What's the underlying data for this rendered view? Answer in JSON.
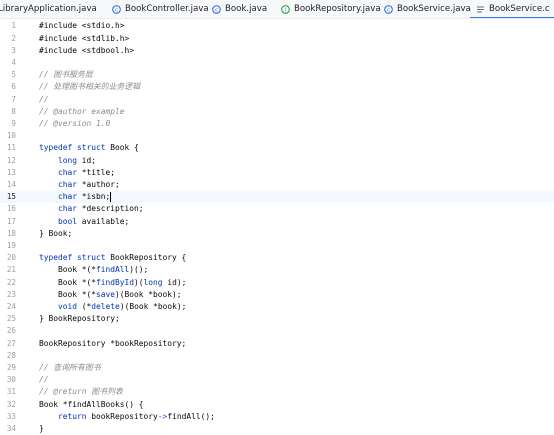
{
  "tabs": [
    {
      "label": "LibraryApplication.java",
      "icon": "java-class-icon",
      "active": false
    },
    {
      "label": "BookController.java",
      "icon": "java-class-icon",
      "active": false
    },
    {
      "label": "Book.java",
      "icon": "java-class-icon",
      "active": false
    },
    {
      "label": "BookRepository.java",
      "icon": "java-interface-icon",
      "active": false
    },
    {
      "label": "BookService.java",
      "icon": "java-class-icon",
      "active": false
    },
    {
      "label": "BookService.c",
      "icon": "text-file-icon",
      "active": true
    }
  ],
  "colors": {
    "accent": "#3574f0",
    "keyword": "#0033b3",
    "comment": "#8c8c8c",
    "current_line": "#f5f8fe"
  },
  "editor": {
    "current_line_number": 15,
    "lines": [
      {
        "n": "1",
        "tokens": [
          {
            "t": "#include <stdio.h>",
            "c": "pp"
          }
        ]
      },
      {
        "n": "2",
        "tokens": [
          {
            "t": "#include <stdlib.h>",
            "c": "pp"
          }
        ]
      },
      {
        "n": "3",
        "tokens": [
          {
            "t": "#include <stdbool.h>",
            "c": "pp"
          }
        ]
      },
      {
        "n": "4",
        "tokens": []
      },
      {
        "n": "5",
        "tokens": [
          {
            "t": "// 图书服务层",
            "c": "cm"
          }
        ]
      },
      {
        "n": "6",
        "tokens": [
          {
            "t": "// 处理图书相关的业务逻辑",
            "c": "cm"
          }
        ]
      },
      {
        "n": "7",
        "tokens": [
          {
            "t": "//",
            "c": "cm"
          }
        ]
      },
      {
        "n": "8",
        "tokens": [
          {
            "t": "// @author example",
            "c": "cm"
          }
        ]
      },
      {
        "n": "9",
        "tokens": [
          {
            "t": "// @version 1.0",
            "c": "cm"
          }
        ]
      },
      {
        "n": "10",
        "tokens": []
      },
      {
        "n": "11",
        "tokens": [
          {
            "t": "typedef",
            "c": "kw"
          },
          {
            "t": " "
          },
          {
            "t": "struct",
            "c": "kw"
          },
          {
            "t": " Book {"
          }
        ]
      },
      {
        "n": "12",
        "tokens": [
          {
            "t": "    "
          },
          {
            "t": "long",
            "c": "kw"
          },
          {
            "t": " id;"
          }
        ]
      },
      {
        "n": "13",
        "tokens": [
          {
            "t": "    "
          },
          {
            "t": "char",
            "c": "kw"
          },
          {
            "t": " *title;"
          }
        ]
      },
      {
        "n": "14",
        "tokens": [
          {
            "t": "    "
          },
          {
            "t": "char",
            "c": "kw"
          },
          {
            "t": " *author;"
          }
        ]
      },
      {
        "n": "15",
        "tokens": [
          {
            "t": "    "
          },
          {
            "t": "char",
            "c": "kw"
          },
          {
            "t": " *isbn;"
          }
        ],
        "caret": true
      },
      {
        "n": "16",
        "tokens": [
          {
            "t": "    "
          },
          {
            "t": "char",
            "c": "kw"
          },
          {
            "t": " *description;"
          }
        ]
      },
      {
        "n": "17",
        "tokens": [
          {
            "t": "    "
          },
          {
            "t": "bool",
            "c": "kw"
          },
          {
            "t": " available;"
          }
        ]
      },
      {
        "n": "18",
        "tokens": [
          {
            "t": "} Book;"
          }
        ]
      },
      {
        "n": "19",
        "tokens": []
      },
      {
        "n": "20",
        "tokens": [
          {
            "t": "typedef",
            "c": "kw"
          },
          {
            "t": " "
          },
          {
            "t": "struct",
            "c": "kw"
          },
          {
            "t": " BookRepository {"
          }
        ]
      },
      {
        "n": "21",
        "tokens": [
          {
            "t": "    Book *(*"
          },
          {
            "t": "findAll",
            "c": "kw"
          },
          {
            "t": ")();"
          }
        ]
      },
      {
        "n": "22",
        "tokens": [
          {
            "t": "    Book *(*"
          },
          {
            "t": "findById",
            "c": "kw"
          },
          {
            "t": ")("
          },
          {
            "t": "long",
            "c": "kw"
          },
          {
            "t": " id);"
          }
        ]
      },
      {
        "n": "23",
        "tokens": [
          {
            "t": "    Book *(*"
          },
          {
            "t": "save",
            "c": "kw"
          },
          {
            "t": ")(Book *book);"
          }
        ]
      },
      {
        "n": "24",
        "tokens": [
          {
            "t": "    "
          },
          {
            "t": "void",
            "c": "kw"
          },
          {
            "t": " (*"
          },
          {
            "t": "delete",
            "c": "kw"
          },
          {
            "t": ")(Book *book);"
          }
        ]
      },
      {
        "n": "25",
        "tokens": [
          {
            "t": "} BookRepository;"
          }
        ]
      },
      {
        "n": "26",
        "tokens": []
      },
      {
        "n": "27",
        "tokens": [
          {
            "t": "BookRepository *bookRepository;"
          }
        ]
      },
      {
        "n": "28",
        "tokens": []
      },
      {
        "n": "29",
        "tokens": [
          {
            "t": "// 查询所有图书",
            "c": "cm"
          }
        ]
      },
      {
        "n": "30",
        "tokens": [
          {
            "t": "//",
            "c": "cm"
          }
        ]
      },
      {
        "n": "31",
        "tokens": [
          {
            "t": "// @return 图书列表",
            "c": "cm"
          }
        ]
      },
      {
        "n": "32",
        "tokens": [
          {
            "t": "Book *findAllBooks() {"
          }
        ]
      },
      {
        "n": "33",
        "tokens": [
          {
            "t": "    "
          },
          {
            "t": "return",
            "c": "kw"
          },
          {
            "t": " bookRepository"
          },
          {
            "t": "->",
            "c": "op"
          },
          {
            "t": "findAll();"
          }
        ]
      },
      {
        "n": "34",
        "tokens": [
          {
            "t": "}"
          }
        ]
      }
    ]
  }
}
